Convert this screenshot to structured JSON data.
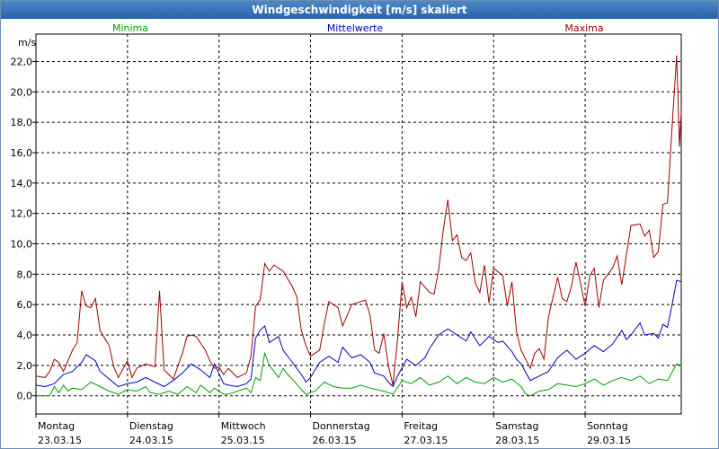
{
  "window": {
    "title": "Windgeschwindigkeit [m/s] skaliert"
  },
  "chart_data": {
    "type": "line",
    "title": "Windgeschwindigkeit [m/s] skaliert",
    "ylabel": "m/s",
    "ylim": [
      -1.2,
      23.8
    ],
    "xlim": [
      0,
      7.05
    ],
    "yticks": [
      "0,0",
      "2,0",
      "4,0",
      "6,0",
      "8,0",
      "10,0",
      "12,0",
      "14,0",
      "16,0",
      "18,0",
      "20,0",
      "22,0"
    ],
    "yticks_values": [
      0,
      2,
      4,
      6,
      8,
      10,
      12,
      14,
      16,
      18,
      20,
      22
    ],
    "xticks": [
      {
        "day": "Montag",
        "date": "23.03.15",
        "x": 0
      },
      {
        "day": "Dienstag",
        "date": "24.03.15",
        "x": 1
      },
      {
        "day": "Mittwoch",
        "date": "25.03.15",
        "x": 2
      },
      {
        "day": "Donnerstag",
        "date": "26.03.15",
        "x": 3
      },
      {
        "day": "Freitag",
        "date": "27.03.15",
        "x": 4
      },
      {
        "day": "Samstag",
        "date": "28.03.15",
        "x": 5
      },
      {
        "day": "Sonntag",
        "date": "29.03.15",
        "x": 6
      }
    ],
    "grid": true,
    "legend_position": "top",
    "series": [
      {
        "name": "Minima",
        "color": "#00a000",
        "points": [
          [
            0,
            0
          ],
          [
            0.15,
            0
          ],
          [
            0.2,
            0.6
          ],
          [
            0.25,
            0.2
          ],
          [
            0.3,
            0.7
          ],
          [
            0.35,
            0.3
          ],
          [
            0.4,
            0.5
          ],
          [
            0.5,
            0.4
          ],
          [
            0.6,
            0.9
          ],
          [
            0.7,
            0.6
          ],
          [
            0.8,
            0.3
          ],
          [
            0.9,
            0.1
          ],
          [
            1.0,
            0.4
          ],
          [
            1.1,
            0.3
          ],
          [
            1.2,
            0.6
          ],
          [
            1.25,
            0.2
          ],
          [
            1.35,
            0.1
          ],
          [
            1.45,
            0.3
          ],
          [
            1.55,
            0.1
          ],
          [
            1.65,
            0.6
          ],
          [
            1.75,
            0.2
          ],
          [
            1.8,
            0.7
          ],
          [
            1.9,
            0.2
          ],
          [
            1.95,
            0.5
          ],
          [
            2.05,
            0.1
          ],
          [
            2.1,
            0.1
          ],
          [
            2.2,
            0.3
          ],
          [
            2.3,
            0.5
          ],
          [
            2.35,
            0.2
          ],
          [
            2.4,
            1.2
          ],
          [
            2.45,
            1.0
          ],
          [
            2.5,
            2.8
          ],
          [
            2.55,
            2.0
          ],
          [
            2.6,
            1.6
          ],
          [
            2.65,
            1.2
          ],
          [
            2.7,
            1.8
          ],
          [
            2.75,
            1.4
          ],
          [
            2.8,
            1.1
          ],
          [
            2.9,
            0.4
          ],
          [
            2.95,
            0.1
          ],
          [
            3.05,
            0.3
          ],
          [
            3.15,
            0.9
          ],
          [
            3.25,
            0.6
          ],
          [
            3.35,
            0.5
          ],
          [
            3.45,
            0.5
          ],
          [
            3.55,
            0.7
          ],
          [
            3.65,
            0.5
          ],
          [
            3.8,
            0.3
          ],
          [
            3.9,
            0.1
          ],
          [
            4.0,
            1.0
          ],
          [
            4.1,
            0.8
          ],
          [
            4.2,
            1.2
          ],
          [
            4.3,
            0.7
          ],
          [
            4.4,
            0.9
          ],
          [
            4.5,
            1.3
          ],
          [
            4.6,
            0.8
          ],
          [
            4.7,
            1.2
          ],
          [
            4.8,
            0.9
          ],
          [
            4.9,
            0.8
          ],
          [
            5.0,
            1.2
          ],
          [
            5.1,
            0.9
          ],
          [
            5.2,
            1.1
          ],
          [
            5.3,
            0.6
          ],
          [
            5.35,
            0.1
          ],
          [
            5.4,
            0.0
          ],
          [
            5.5,
            0.3
          ],
          [
            5.6,
            0.4
          ],
          [
            5.7,
            0.8
          ],
          [
            5.8,
            0.7
          ],
          [
            5.9,
            0.6
          ],
          [
            6.0,
            0.8
          ],
          [
            6.1,
            1.1
          ],
          [
            6.2,
            0.7
          ],
          [
            6.3,
            1.0
          ],
          [
            6.4,
            1.2
          ],
          [
            6.5,
            1.0
          ],
          [
            6.6,
            1.3
          ],
          [
            6.7,
            0.8
          ],
          [
            6.8,
            1.1
          ],
          [
            6.9,
            1.0
          ],
          [
            7.0,
            2.1
          ],
          [
            7.05,
            2.0
          ]
        ]
      },
      {
        "name": "Mittelwerte",
        "color": "#0000c0",
        "points": [
          [
            0,
            0.7
          ],
          [
            0.1,
            0.6
          ],
          [
            0.2,
            0.8
          ],
          [
            0.3,
            1.4
          ],
          [
            0.4,
            1.6
          ],
          [
            0.5,
            2.2
          ],
          [
            0.55,
            2.7
          ],
          [
            0.65,
            2.3
          ],
          [
            0.7,
            1.6
          ],
          [
            0.8,
            1.1
          ],
          [
            0.9,
            0.6
          ],
          [
            1.0,
            0.8
          ],
          [
            1.1,
            0.9
          ],
          [
            1.2,
            1.2
          ],
          [
            1.3,
            0.9
          ],
          [
            1.4,
            0.6
          ],
          [
            1.5,
            1.0
          ],
          [
            1.6,
            1.5
          ],
          [
            1.7,
            2.1
          ],
          [
            1.8,
            1.7
          ],
          [
            1.9,
            1.2
          ],
          [
            1.95,
            2.1
          ],
          [
            2.05,
            0.8
          ],
          [
            2.1,
            0.7
          ],
          [
            2.2,
            0.6
          ],
          [
            2.3,
            0.8
          ],
          [
            2.35,
            1.1
          ],
          [
            2.4,
            3.8
          ],
          [
            2.45,
            4.3
          ],
          [
            2.5,
            4.6
          ],
          [
            2.55,
            3.5
          ],
          [
            2.65,
            3.9
          ],
          [
            2.7,
            3.0
          ],
          [
            2.8,
            2.2
          ],
          [
            2.9,
            1.4
          ],
          [
            2.95,
            0.9
          ],
          [
            3.0,
            1.2
          ],
          [
            3.1,
            2.2
          ],
          [
            3.2,
            2.6
          ],
          [
            3.3,
            2.2
          ],
          [
            3.35,
            3.2
          ],
          [
            3.45,
            2.5
          ],
          [
            3.55,
            2.7
          ],
          [
            3.65,
            2.2
          ],
          [
            3.7,
            1.5
          ],
          [
            3.8,
            1.3
          ],
          [
            3.85,
            0.9
          ],
          [
            3.9,
            0.6
          ],
          [
            3.95,
            1.3
          ],
          [
            4.05,
            2.4
          ],
          [
            4.15,
            2.0
          ],
          [
            4.25,
            2.5
          ],
          [
            4.3,
            3.1
          ],
          [
            4.4,
            4.0
          ],
          [
            4.5,
            4.4
          ],
          [
            4.6,
            4.0
          ],
          [
            4.7,
            3.6
          ],
          [
            4.75,
            4.2
          ],
          [
            4.85,
            3.3
          ],
          [
            4.95,
            3.9
          ],
          [
            5.05,
            3.5
          ],
          [
            5.1,
            3.6
          ],
          [
            5.2,
            2.9
          ],
          [
            5.25,
            2.4
          ],
          [
            5.3,
            2.1
          ],
          [
            5.4,
            1.0
          ],
          [
            5.5,
            1.3
          ],
          [
            5.6,
            1.6
          ],
          [
            5.7,
            2.5
          ],
          [
            5.8,
            3.0
          ],
          [
            5.9,
            2.4
          ],
          [
            6.0,
            2.8
          ],
          [
            6.1,
            3.3
          ],
          [
            6.2,
            2.9
          ],
          [
            6.3,
            3.4
          ],
          [
            6.4,
            4.3
          ],
          [
            6.45,
            3.7
          ],
          [
            6.5,
            4.0
          ],
          [
            6.6,
            4.8
          ],
          [
            6.65,
            4.0
          ],
          [
            6.75,
            4.1
          ],
          [
            6.8,
            3.8
          ],
          [
            6.85,
            4.7
          ],
          [
            6.9,
            4.5
          ],
          [
            6.95,
            6.0
          ],
          [
            7.0,
            7.6
          ],
          [
            7.05,
            7.5
          ]
        ]
      },
      {
        "name": "Maxima",
        "color": "#a00000",
        "points": [
          [
            0,
            1.3
          ],
          [
            0.1,
            1.2
          ],
          [
            0.15,
            1.6
          ],
          [
            0.2,
            2.4
          ],
          [
            0.25,
            2.2
          ],
          [
            0.3,
            1.6
          ],
          [
            0.35,
            2.3
          ],
          [
            0.4,
            3.0
          ],
          [
            0.45,
            3.5
          ],
          [
            0.5,
            6.9
          ],
          [
            0.55,
            5.9
          ],
          [
            0.6,
            5.8
          ],
          [
            0.65,
            6.4
          ],
          [
            0.7,
            4.3
          ],
          [
            0.8,
            3.3
          ],
          [
            0.85,
            1.9
          ],
          [
            0.9,
            1.2
          ],
          [
            1.0,
            2.3
          ],
          [
            1.05,
            1.2
          ],
          [
            1.1,
            1.8
          ],
          [
            1.2,
            2.1
          ],
          [
            1.3,
            1.9
          ],
          [
            1.35,
            6.9
          ],
          [
            1.4,
            1.7
          ],
          [
            1.5,
            1.1
          ],
          [
            1.6,
            2.8
          ],
          [
            1.65,
            3.9
          ],
          [
            1.7,
            4.0
          ],
          [
            1.75,
            3.9
          ],
          [
            1.85,
            3.0
          ],
          [
            1.9,
            2.3
          ],
          [
            1.95,
            1.8
          ],
          [
            2.0,
            1.9
          ],
          [
            2.05,
            1.4
          ],
          [
            2.1,
            1.8
          ],
          [
            2.2,
            1.2
          ],
          [
            2.3,
            1.5
          ],
          [
            2.35,
            2.6
          ],
          [
            2.4,
            5.9
          ],
          [
            2.45,
            6.3
          ],
          [
            2.5,
            8.7
          ],
          [
            2.55,
            8.2
          ],
          [
            2.6,
            8.6
          ],
          [
            2.7,
            8.2
          ],
          [
            2.8,
            7.2
          ],
          [
            2.85,
            6.5
          ],
          [
            2.9,
            4.3
          ],
          [
            2.95,
            3.3
          ],
          [
            3.0,
            2.6
          ],
          [
            3.1,
            3.0
          ],
          [
            3.15,
            4.7
          ],
          [
            3.2,
            6.2
          ],
          [
            3.3,
            5.8
          ],
          [
            3.35,
            4.6
          ],
          [
            3.45,
            6.0
          ],
          [
            3.55,
            6.2
          ],
          [
            3.6,
            6.3
          ],
          [
            3.65,
            5.3
          ],
          [
            3.7,
            3.0
          ],
          [
            3.75,
            2.8
          ],
          [
            3.8,
            4.1
          ],
          [
            3.85,
            2.0
          ],
          [
            3.9,
            0.7
          ],
          [
            3.95,
            3.7
          ],
          [
            4.0,
            7.5
          ],
          [
            4.05,
            5.8
          ],
          [
            4.1,
            6.5
          ],
          [
            4.15,
            5.2
          ],
          [
            4.2,
            7.5
          ],
          [
            4.3,
            6.8
          ],
          [
            4.35,
            6.7
          ],
          [
            4.4,
            8.3
          ],
          [
            4.45,
            10.9
          ],
          [
            4.5,
            12.9
          ],
          [
            4.55,
            10.2
          ],
          [
            4.6,
            10.6
          ],
          [
            4.65,
            9.1
          ],
          [
            4.7,
            8.9
          ],
          [
            4.75,
            9.4
          ],
          [
            4.8,
            7.4
          ],
          [
            4.85,
            6.8
          ],
          [
            4.9,
            8.6
          ],
          [
            4.95,
            6.1
          ],
          [
            5.0,
            8.4
          ],
          [
            5.1,
            7.9
          ],
          [
            5.15,
            5.9
          ],
          [
            5.2,
            7.5
          ],
          [
            5.25,
            4.2
          ],
          [
            5.3,
            3.0
          ],
          [
            5.4,
            1.8
          ],
          [
            5.45,
            2.8
          ],
          [
            5.5,
            3.1
          ],
          [
            5.55,
            2.4
          ],
          [
            5.6,
            5.2
          ],
          [
            5.7,
            7.8
          ],
          [
            5.75,
            6.4
          ],
          [
            5.8,
            6.2
          ],
          [
            5.85,
            7.2
          ],
          [
            5.9,
            8.8
          ],
          [
            6.0,
            5.9
          ],
          [
            6.05,
            7.9
          ],
          [
            6.1,
            8.4
          ],
          [
            6.15,
            5.8
          ],
          [
            6.2,
            7.6
          ],
          [
            6.3,
            8.4
          ],
          [
            6.35,
            9.2
          ],
          [
            6.4,
            7.3
          ],
          [
            6.5,
            11.2
          ],
          [
            6.6,
            11.3
          ],
          [
            6.65,
            10.5
          ],
          [
            6.7,
            10.9
          ],
          [
            6.75,
            9.1
          ],
          [
            6.8,
            9.5
          ],
          [
            6.85,
            12.6
          ],
          [
            6.9,
            12.7
          ],
          [
            6.95,
            17.7
          ],
          [
            7.0,
            22.4
          ],
          [
            7.03,
            16.4
          ],
          [
            7.05,
            18.7
          ]
        ]
      }
    ]
  }
}
